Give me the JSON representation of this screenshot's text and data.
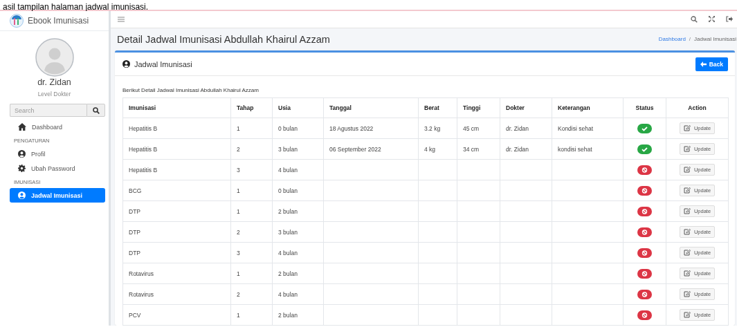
{
  "caption": "asil tampilan halaman jadwal imunisasi.",
  "sidebar": {
    "brand": "Ebook Imunisasi",
    "user": {
      "name": "dr. Zidan",
      "level": "Level Dokter"
    },
    "search": {
      "placeholder": "Search"
    },
    "items": [
      {
        "kind": "link",
        "label": "Dashboard",
        "selected": false
      },
      {
        "kind": "header",
        "label": "PENGATURAN"
      },
      {
        "kind": "link",
        "label": "Profil",
        "selected": false
      },
      {
        "kind": "link",
        "label": "Ubah Password",
        "selected": false
      },
      {
        "kind": "header",
        "label": "IMUNISASI"
      },
      {
        "kind": "link",
        "label": "Jadwal Imunisasi",
        "selected": true
      }
    ]
  },
  "page": {
    "title": "Detail Jadwal Imunisasi Abdullah Khairul Azzam",
    "breadcrumb": [
      "Dashboard",
      "Jadwal Imunisasi"
    ],
    "breadcrumb_separator": "/"
  },
  "card": {
    "title": "Jadwal Imunisasi",
    "back_button": "Back",
    "description": "Berikut Detail Jadwal Imunisasi Abdullah Khairul Azzam"
  },
  "table": {
    "columns": [
      "Imunisasi",
      "Tahap",
      "Usia",
      "Tanggal",
      "Berat",
      "Tinggi",
      "Dokter",
      "Keterangan",
      "Status",
      "Action"
    ],
    "rows": [
      {
        "imunisasi": "Hepatitis B",
        "tahap": "1",
        "usia": "0 bulan",
        "tanggal": "18 Agustus 2022",
        "berat": "3.2 kg",
        "tinggi": "45 cm",
        "dokter": "dr. Zidan",
        "keterangan": "Kondisi sehat",
        "done": true,
        "action": "Update"
      },
      {
        "imunisasi": "Hepatitis B",
        "tahap": "2",
        "usia": "3 bulan",
        "tanggal": "06 September 2022",
        "berat": "4 kg",
        "tinggi": "34 cm",
        "dokter": "dr. Zidan",
        "keterangan": "kondisi sehat",
        "done": true,
        "action": "Update"
      },
      {
        "imunisasi": "Hepatitis B",
        "tahap": "3",
        "usia": "4 bulan",
        "done": false,
        "action": "Update"
      },
      {
        "imunisasi": "BCG",
        "tahap": "1",
        "usia": "0 bulan",
        "done": false,
        "action": "Update"
      },
      {
        "imunisasi": "DTP",
        "tahap": "1",
        "usia": "2 bulan",
        "done": false,
        "action": "Update"
      },
      {
        "imunisasi": "DTP",
        "tahap": "2",
        "usia": "3 bulan",
        "done": false,
        "action": "Update"
      },
      {
        "imunisasi": "DTP",
        "tahap": "3",
        "usia": "4 bulan",
        "done": false,
        "action": "Update"
      },
      {
        "imunisasi": "Rotavirus",
        "tahap": "1",
        "usia": "2 bulan",
        "done": false,
        "action": "Update"
      },
      {
        "imunisasi": "Rotavirus",
        "tahap": "2",
        "usia": "4 bulan",
        "done": false,
        "action": "Update"
      },
      {
        "imunisasi": "PCV",
        "tahap": "1",
        "usia": "2 bulan",
        "done": false,
        "action": "Update"
      }
    ]
  }
}
